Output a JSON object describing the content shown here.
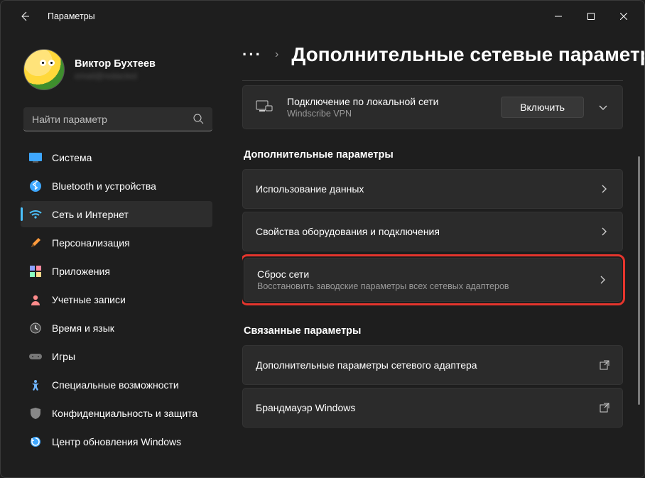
{
  "titlebar": {
    "app_title": "Параметры"
  },
  "profile": {
    "name": "Виктор Бухтеев",
    "email": "email@redacted"
  },
  "search": {
    "placeholder": "Найти параметр"
  },
  "nav": [
    {
      "label": "Система",
      "icon": "🖥️",
      "color": "#4cc2ff"
    },
    {
      "label": "Bluetooth и устройства",
      "icon": "bt",
      "color": "#4cc2ff"
    },
    {
      "label": "Сеть и Интернет",
      "icon": "wifi",
      "color": "#4cc2ff",
      "active": true
    },
    {
      "label": "Персонализация",
      "icon": "✏️",
      "color": "#ff9b3d"
    },
    {
      "label": "Приложения",
      "icon": "▦",
      "color": "#8aa0ff"
    },
    {
      "label": "Учетные записи",
      "icon": "👤",
      "color": "#ff8b8b"
    },
    {
      "label": "Время и язык",
      "icon": "🕒",
      "color": "#b9b9b9"
    },
    {
      "label": "Игры",
      "icon": "🎮",
      "color": "#9a9a9a"
    },
    {
      "label": "Специальные возможности",
      "icon": "♿",
      "color": "#6fb5ff"
    },
    {
      "label": "Конфиденциальность и защита",
      "icon": "🛡️",
      "color": "#9a9a9a"
    },
    {
      "label": "Центр обновления Windows",
      "icon": "🔄",
      "color": "#3ea7ff"
    }
  ],
  "breadcrumb": {
    "dots": "···",
    "sep": "›",
    "title": "Дополнительные сетевые параметр"
  },
  "conn_card": {
    "title": "Подключение по локальной сети",
    "sub": "Windscribe VPN",
    "action": "Включить"
  },
  "sections": {
    "more": "Дополнительные параметры",
    "related": "Связанные параметры"
  },
  "items": {
    "data_usage": {
      "title": "Использование данных"
    },
    "hw_props": {
      "title": "Свойства оборудования и подключения"
    },
    "net_reset": {
      "title": "Сброс сети",
      "sub": "Восстановить заводские параметры всех сетевых адаптеров"
    },
    "adapter_opts": {
      "title": "Дополнительные параметры сетевого адаптера"
    },
    "firewall": {
      "title": "Брандмауэр Windows"
    }
  }
}
